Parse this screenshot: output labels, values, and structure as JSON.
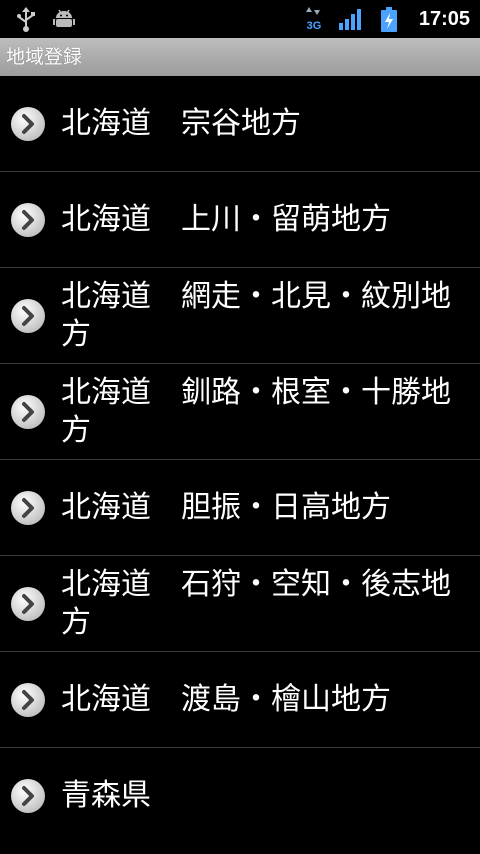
{
  "status_bar": {
    "time": "17:05",
    "network_type": "3G",
    "icons": [
      "usb-icon",
      "debug-icon",
      "3g-data-icon",
      "signal-icon",
      "battery-charging-icon"
    ]
  },
  "title": "地域登録",
  "regions": [
    {
      "label": "北海道　宗谷地方"
    },
    {
      "label": "北海道　上川・留萌地方"
    },
    {
      "label": "北海道　網走・北見・紋別地方"
    },
    {
      "label": "北海道　釧路・根室・十勝地方"
    },
    {
      "label": "北海道　胆振・日高地方"
    },
    {
      "label": "北海道　石狩・空知・後志地方"
    },
    {
      "label": "北海道　渡島・檜山地方"
    },
    {
      "label": "青森県"
    }
  ],
  "colors": {
    "background": "#000000",
    "title_bar": "#aaaaaa",
    "divider": "#3a3a3a",
    "text": "#ffffff"
  }
}
